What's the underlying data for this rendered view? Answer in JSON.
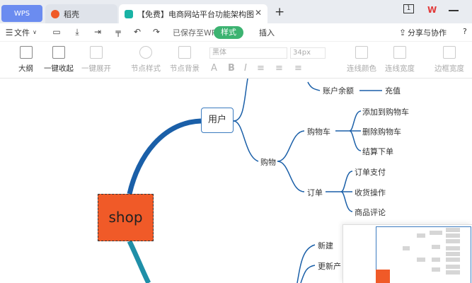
{
  "titlebar": {
    "tabs": [
      {
        "label": "WPS"
      },
      {
        "label": "稻壳"
      },
      {
        "label": "【免费】电商网站平台功能架构图"
      }
    ],
    "plus": "+",
    "close": "✕",
    "right_badge": "1"
  },
  "toolbar1": {
    "file_menu": "文件",
    "saved_status": "已保存至WPS",
    "style_tab": "样式",
    "insert_tab": "插入",
    "share": "分享与协作",
    "help": "?"
  },
  "toolbar2": {
    "outline": "大纲",
    "collapse_all": "一键收起",
    "expand_all": "一键展开",
    "node_style": "节点样式",
    "node_background": "节点背景",
    "font_name": "黑体",
    "font_size": "34px",
    "line_color": "连线颜色",
    "line_width": "连线宽度",
    "border_width": "边框宽度"
  },
  "mindmap": {
    "root": "shop",
    "user": "用户",
    "account_balance": "账户余额",
    "recharge": "充值",
    "shopping": "购物",
    "cart": "购物车",
    "add_to_cart": "添加到购物车",
    "remove_from_cart": "删除购物车",
    "checkout": "结算下单",
    "order": "订单",
    "order_pay": "订单支付",
    "receive_goods": "收货操作",
    "product_review": "商品评论",
    "new": "新建",
    "update_product": "更新产"
  },
  "colors": {
    "accent_green": "#3cb371",
    "branch_blue": "#1a5fa8",
    "branch_teal": "#1f8fa8",
    "root_orange": "#f05a28",
    "wps_tab": "#6b8cf0"
  }
}
